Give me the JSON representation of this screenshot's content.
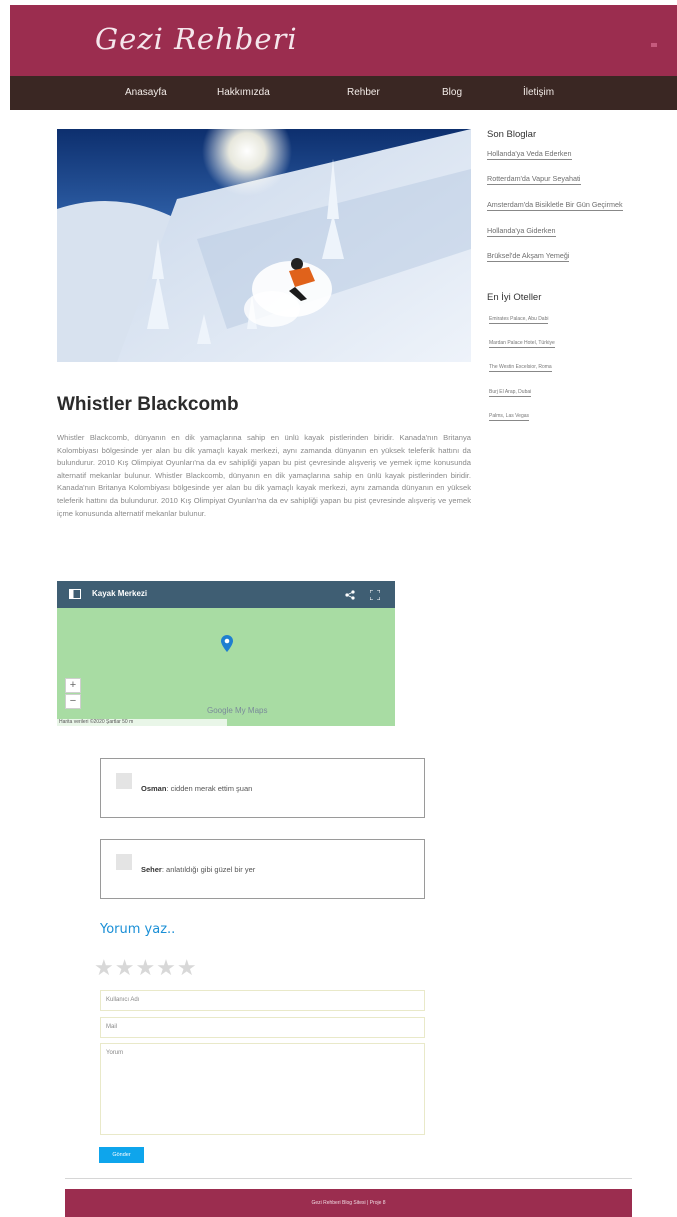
{
  "header": {
    "site_title": "Gezi Rehberi"
  },
  "nav": {
    "items": [
      "Anasayfa",
      "Hakkımızda",
      "Rehber",
      "Blog",
      "İletişim"
    ]
  },
  "post": {
    "title": "Whistler Blackcomb",
    "body": "Whistler Blackcomb, dünyanın en dik yamaçlarına sahip en ünlü kayak pistlerinden biridir. Kanada'nın Britanya Kolombiyası bölgesinde yer alan bu dik yamaçlı kayak merkezi, aynı zamanda dünyanın en yüksek teleferik hattını da bulundurur. 2010 Kış Olimpiyat Oyunları'na da ev sahipliği yapan bu pist çevresinde alışveriş ve yemek içme konusunda alternatif mekanlar bulunur. Whistler Blackcomb, dünyanın en dik yamaçlarına sahip en ünlü kayak pistlerinden biridir. Kanada'nın Britanya Kolombiyası bölgesinde yer alan bu dik yamaçlı kayak merkezi, aynı zamanda dünyanın en yüksek teleferik hattını da bulundurur. 2010 Kış Olimpiyat Oyunları'na da ev sahipliği yapan bu pist çevresinde alışveriş ve yemek içme konusunda alternatif mekanlar bulunur."
  },
  "map": {
    "title": "Kayak Merkezi",
    "zoom_in": "+",
    "zoom_out": "−",
    "brand": "Google My Maps",
    "attribution": "Harita verileri ©2020   Şartlar   50 m"
  },
  "comments": [
    {
      "author": "Osman",
      "text": ": cidden merak ettim şuan"
    },
    {
      "author": "Seher",
      "text": ": anlatıldığı gibi güzel bir yer"
    }
  ],
  "form": {
    "title": "Yorum yaz..",
    "stars": "★★★★★",
    "username_placeholder": "Kullanıcı Adı",
    "mail_placeholder": "Mail",
    "comment_placeholder": "Yorum",
    "submit_label": "Gönder"
  },
  "sidebar": {
    "blogs_heading": "Son Bloglar",
    "blogs": [
      "Hollanda'ya Veda Ederken",
      "Rotterdam'da Vapur Seyahati",
      "Amsterdam'da Bisikletle Bir Gün Geçirmek",
      "Hollanda'ya Giderken",
      "Brüksel'de Akşam Yemeği"
    ],
    "hotels_heading": "En İyi Oteller",
    "hotels": [
      "Emirates Palace, Abu Dabi",
      "Mardan Palace Hotel, Türkiye",
      "The Westin Excelsior, Roma",
      "Burj El Arap, Dubai",
      "Palms, Las Vegas"
    ]
  },
  "footer": {
    "text": "Gezi Rehberi Blog Sitesi | Proje 8"
  },
  "colors": {
    "brand": "#9b2d4f",
    "nav": "#3a2723",
    "accent": "#0ea5ec",
    "map": "#a8dca3"
  }
}
